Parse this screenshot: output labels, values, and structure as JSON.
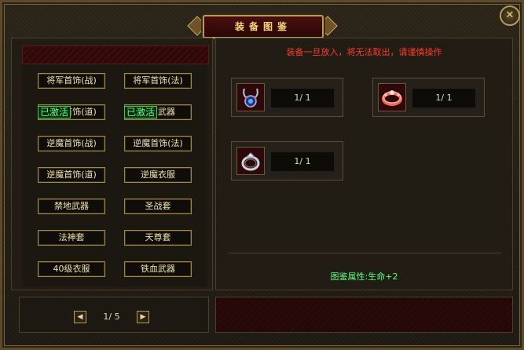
{
  "window": {
    "title": "装备图鉴",
    "close_label": "✕"
  },
  "left": {
    "sets": [
      {
        "label": "将军首饰(战)"
      },
      {
        "label": "将军首饰(法)"
      },
      {
        "label": "将军首饰(道)"
      },
      {
        "label": "将军武器"
      },
      {
        "label": "逆魔首饰(战)"
      },
      {
        "label": "逆魔首饰(法)"
      },
      {
        "label": "逆魔首饰(道)"
      },
      {
        "label": "逆魔衣服"
      },
      {
        "label": "禁地武器"
      },
      {
        "label": "圣战套"
      },
      {
        "label": "法神套"
      },
      {
        "label": "天尊套"
      },
      {
        "label": "40级衣服"
      },
      {
        "label": "铁血武器"
      }
    ],
    "activated_label": "已激活",
    "activated_badges": [
      {
        "target": "将军首饰(道)",
        "label": "已激活"
      },
      {
        "target": "将军武器",
        "label": "已激活"
      }
    ],
    "pager": {
      "prev_icon": "left-arrow-icon",
      "next_icon": "right-arrow-icon",
      "page_text": "1/ 5"
    }
  },
  "right": {
    "warning": "装备一旦放入，将无法取出，请谨慎操作",
    "slots": [
      {
        "icon": "necklace-icon",
        "count": "1/ 1"
      },
      {
        "icon": "bracelet-icon",
        "count": "1/ 1"
      },
      {
        "icon": "ring-icon",
        "count": "1/ 1"
      }
    ],
    "attribute": "图鉴属性:生命+2"
  },
  "colors": {
    "accent_gold": "#b89a5a",
    "active_green": "#5cff7e",
    "warning_red": "#ff3a2a"
  }
}
